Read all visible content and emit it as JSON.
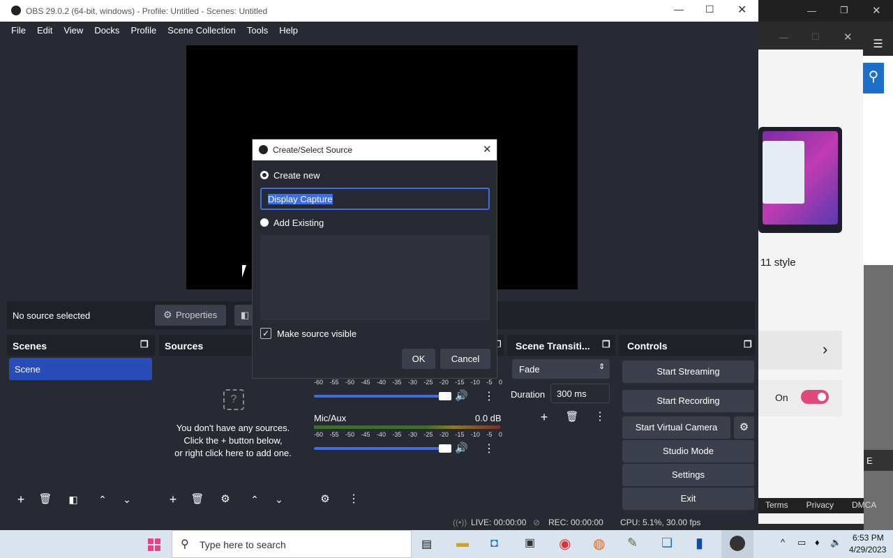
{
  "obs": {
    "window_title": "OBS 29.0.2 (64-bit, windows) - Profile: Untitled - Scenes: Untitled",
    "menu": [
      "File",
      "Edit",
      "View",
      "Docks",
      "Profile",
      "Scene Collection",
      "Tools",
      "Help"
    ],
    "source_bar": {
      "no_source": "No source selected",
      "properties_label": "Properties"
    },
    "scenes": {
      "title": "Scenes",
      "items": [
        "Scene"
      ]
    },
    "sources": {
      "title": "Sources",
      "empty_line1": "You don't have any sources.",
      "empty_line2": "Click the + button below,",
      "empty_line3": "or right click here to add one."
    },
    "mixer": {
      "ticks": [
        "-60",
        "-55",
        "-50",
        "-45",
        "-40",
        "-35",
        "-30",
        "-25",
        "-20",
        "-15",
        "-10",
        "-5",
        "0"
      ],
      "tracks": [
        {
          "name": "",
          "db": ""
        },
        {
          "name": "Mic/Aux",
          "db": "0.0 dB"
        }
      ]
    },
    "transitions": {
      "title": "Scene Transiti...",
      "selected": "Fade",
      "duration_label": "Duration",
      "duration_value": "300 ms"
    },
    "controls": {
      "title": "Controls",
      "buttons": [
        "Start Streaming",
        "Start Recording",
        "Start Virtual Camera",
        "Studio Mode",
        "Settings",
        "Exit"
      ]
    },
    "status": {
      "live": "LIVE: 00:00:00",
      "rec": "REC: 00:00:00",
      "cpu": "CPU: 5.1%, 30.00 fps"
    }
  },
  "dialog": {
    "title": "Create/Select Source",
    "create_new_label": "Create new",
    "name_value": "Display Capture",
    "add_existing_label": "Add Existing",
    "visible_label": "Make source visible",
    "ok_label": "OK",
    "cancel_label": "Cancel"
  },
  "background_page": {
    "text_style": "11 style",
    "toggle_label": "On",
    "footer_links": [
      "Terms",
      "Privacy",
      "DMCA"
    ],
    "letter": "E"
  },
  "taskbar": {
    "search_placeholder": "Type here to search",
    "time": "6:53 PM",
    "date": "4/29/2023"
  },
  "colors": {
    "accent": "#284cb8",
    "panel": "#272a33",
    "toggle": "#e0487a"
  }
}
